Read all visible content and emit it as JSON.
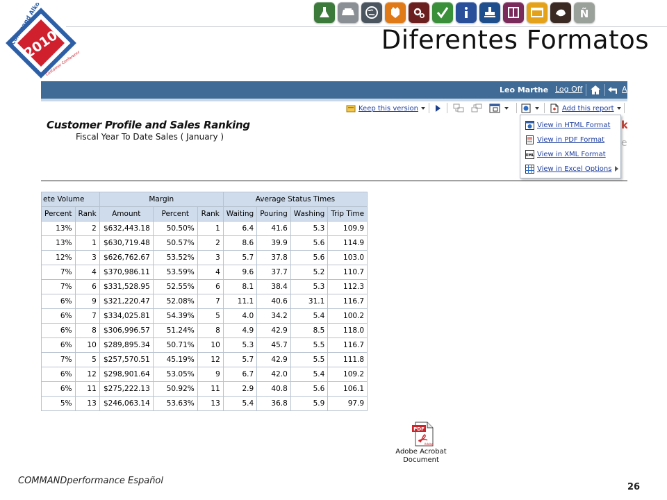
{
  "slide": {
    "title": "Diferentes Formatos",
    "footer": "COMMANDperformance Español",
    "page_number": "26"
  },
  "logo": {
    "top_text": "Command Alkon",
    "year": "2010",
    "bottom_text": "Customer Conference",
    "colors": {
      "blue": "#2d5fa6",
      "red": "#d0202e"
    }
  },
  "icon_tiles": [
    {
      "name": "flask-icon",
      "bg": "#3c7a3c"
    },
    {
      "name": "tray-icon",
      "bg": "#8a8f96"
    },
    {
      "name": "globe-icon",
      "bg": "#4b5560"
    },
    {
      "name": "badge-icon",
      "bg": "#e07a18"
    },
    {
      "name": "gears-icon",
      "bg": "#6b1f1f"
    },
    {
      "name": "checkmark-icon",
      "bg": "#3a8f3a"
    },
    {
      "name": "info-icon",
      "bg": "#2a4f9a"
    },
    {
      "name": "stamp-icon",
      "bg": "#1f4e8c"
    },
    {
      "name": "split-panel-icon",
      "bg": "#7a2b5c"
    },
    {
      "name": "window-icon",
      "bg": "#e3a21a"
    },
    {
      "name": "hand-icon",
      "bg": "#3b2a24"
    },
    {
      "name": "n-tilde-icon",
      "bg": "#9aa09a"
    }
  ],
  "report": {
    "user": "Leo Marthe",
    "logoff_label": "Log Off",
    "partial_link": "A",
    "keep_version_label": "Keep this version",
    "add_report_label": "Add this report",
    "title": "Customer Profile and Sales Ranking",
    "subtitle": "Fiscal Year To Date Sales ( January )",
    "partial_red": "k",
    "partial_gray": "e",
    "export_menu": [
      {
        "label": "View in HTML Format",
        "icon": "html-icon"
      },
      {
        "label": "View in PDF Format",
        "icon": "pdf-doc-icon"
      },
      {
        "label": "View in XML Format",
        "icon": "xml-icon"
      },
      {
        "label": "View in Excel Options",
        "icon": "excel-icon",
        "submenu": true
      }
    ]
  },
  "table": {
    "groups": [
      "ete Volume",
      "Margin",
      "Average Status Times"
    ],
    "columns": [
      "Percent",
      "Rank",
      "Amount",
      "Percent",
      "Rank",
      "Waiting",
      "Pouring",
      "Washing",
      "Trip Time"
    ],
    "rows": [
      [
        "13%",
        "2",
        "$632,443.18",
        "50.50%",
        "1",
        "6.4",
        "41.6",
        "5.3",
        "109.9"
      ],
      [
        "13%",
        "1",
        "$630,719.48",
        "50.57%",
        "2",
        "8.6",
        "39.9",
        "5.6",
        "114.9"
      ],
      [
        "12%",
        "3",
        "$626,762.67",
        "53.52%",
        "3",
        "5.7",
        "37.8",
        "5.6",
        "103.0"
      ],
      [
        "7%",
        "4",
        "$370,986.11",
        "53.59%",
        "4",
        "9.6",
        "37.7",
        "5.2",
        "110.7"
      ],
      [
        "7%",
        "6",
        "$331,528.95",
        "52.55%",
        "6",
        "8.1",
        "38.4",
        "5.3",
        "112.3"
      ],
      [
        "6%",
        "9",
        "$321,220.47",
        "52.08%",
        "7",
        "11.1",
        "40.6",
        "31.1",
        "116.7"
      ],
      [
        "6%",
        "7",
        "$334,025.81",
        "54.39%",
        "5",
        "4.0",
        "34.2",
        "5.4",
        "100.2"
      ],
      [
        "6%",
        "8",
        "$306,996.57",
        "51.24%",
        "8",
        "4.9",
        "42.9",
        "8.5",
        "118.0"
      ],
      [
        "6%",
        "10",
        "$289,895.34",
        "50.71%",
        "10",
        "5.3",
        "45.7",
        "5.5",
        "116.7"
      ],
      [
        "7%",
        "5",
        "$257,570.51",
        "45.19%",
        "12",
        "5.7",
        "42.9",
        "5.5",
        "111.8"
      ],
      [
        "6%",
        "12",
        "$298,901.64",
        "53.05%",
        "9",
        "6.7",
        "42.0",
        "5.4",
        "109.2"
      ],
      [
        "6%",
        "11",
        "$275,222.13",
        "50.92%",
        "11",
        "2.9",
        "40.8",
        "5.6",
        "106.1"
      ],
      [
        "5%",
        "13",
        "$246,063.14",
        "53.63%",
        "13",
        "5.4",
        "36.8",
        "5.9",
        "97.9"
      ]
    ]
  },
  "attachment": {
    "icon_label": "PDF",
    "brand": "Adobe",
    "caption_line1": "Adobe Acrobat",
    "caption_line2": "Document"
  }
}
